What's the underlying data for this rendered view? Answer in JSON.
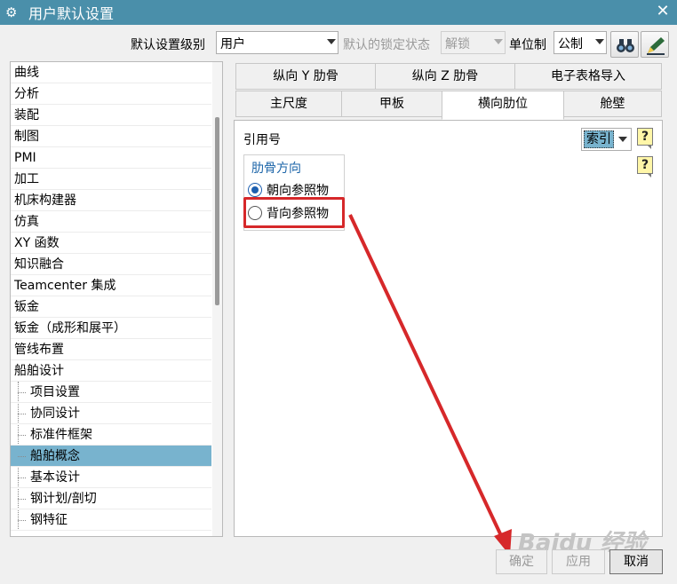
{
  "window": {
    "title": "用户默认设置",
    "close_glyph": "✕",
    "title_icon": "gear-icon"
  },
  "toolbar": {
    "level_label": "默认设置级别",
    "level_value": "用户",
    "lock_label": "默认的锁定状态",
    "lock_value": "解锁",
    "unit_label": "单位制",
    "unit_value": "公制",
    "icons": [
      "binoculars-icon",
      "edit-pen-icon"
    ]
  },
  "tree": {
    "top_items": [
      "曲线",
      "分析",
      "装配",
      "制图",
      "PMI",
      "加工",
      "机床构建器",
      "仿真",
      "XY 函数",
      "知识融合",
      "Teamcenter 集成",
      "钣金",
      "钣金（成形和展平）",
      "管线布置",
      "船舶设计"
    ],
    "child_items": [
      "项目设置",
      "协同设计",
      "标准件框架",
      "船舶概念",
      "基本设计",
      "钢计划/剖切",
      "钢特征"
    ],
    "selected": "船舶概念"
  },
  "tabs": {
    "row1": [
      "纵向 Y 肋骨",
      "纵向 Z 肋骨",
      "电子表格导入"
    ],
    "row2": [
      "主尺度",
      "甲板",
      "横向肋位",
      "舱壁"
    ],
    "active": "横向肋位"
  },
  "panel": {
    "ref_label": "引用号",
    "ref_value": "索引",
    "help_glyph": "?",
    "group_title": "肋骨方向",
    "radio_options": [
      "朝向参照物",
      "背向参照物"
    ],
    "radio_selected": 0
  },
  "buttons": {
    "ok": "确定",
    "apply": "应用",
    "cancel": "取消"
  },
  "watermark": "Baidu 经验",
  "colors": {
    "titlebar": "#4a8faa",
    "selection": "#78b3ce",
    "annotation": "#d6282a"
  }
}
